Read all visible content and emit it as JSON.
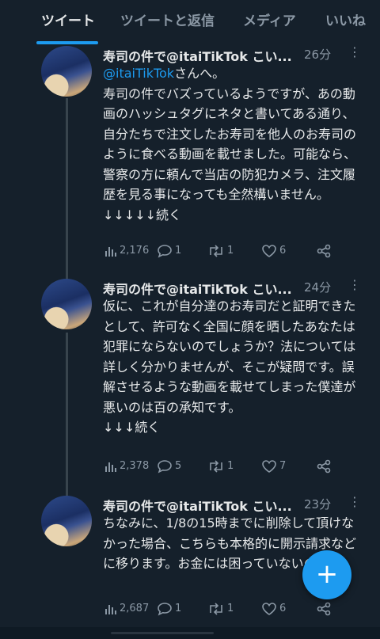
{
  "tabs": [
    {
      "label": "ツイート",
      "active": true
    },
    {
      "label": "ツイートと返信",
      "active": false
    },
    {
      "label": "メディア",
      "active": false
    },
    {
      "label": "いいね",
      "active": false
    }
  ],
  "tweets": [
    {
      "name": "寿司の件で@itaiTikTok こい...",
      "time": "26分",
      "mention": "@itaiTikTok",
      "mention_suffix": "さんへ。",
      "text": "寿司の件でバズっているようですが、あの動画のハッシュタグにネタと書いてある通り、自分たちで注文したお寿司を他人のお寿司のように食べる動画を載せました。可能なら、警察の方に頼んで当店の防犯カメラ、注文履歴を見る事になっても全然構いません。\n↓↓↓↓↓続く",
      "views": "2,176",
      "replies": "1",
      "retweets": "1",
      "likes": "6"
    },
    {
      "name": "寿司の件で@itaiTikTok こい...",
      "time": "24分",
      "text": "仮に、これが自分達のお寿司だと証明できたとして、許可なく全国に顔を晒したあなたは犯罪にならないのでしょうか？法については詳しく分かりませんが、そこが疑問です。誤解させるような動画を載せてしまった僕達が悪いのは百の承知です。\n↓↓↓続く",
      "views": "2,378",
      "replies": "5",
      "retweets": "1",
      "likes": "7"
    },
    {
      "name": "寿司の件で@itaiTikTok こい...",
      "time": "23分",
      "text": "ちなみに、1/8の15時までに削除して頂けなかった場合、こちらも本格的に開示請求などに移ります。お金には困っていないので。",
      "views": "2,687",
      "replies": "1",
      "retweets": "1",
      "likes": "6"
    }
  ],
  "fab": {
    "label": "+"
  },
  "colors": {
    "background": "#15202b",
    "accent": "#1d9bf0",
    "muted": "#8b98a5",
    "text": "#e7e9ea"
  }
}
